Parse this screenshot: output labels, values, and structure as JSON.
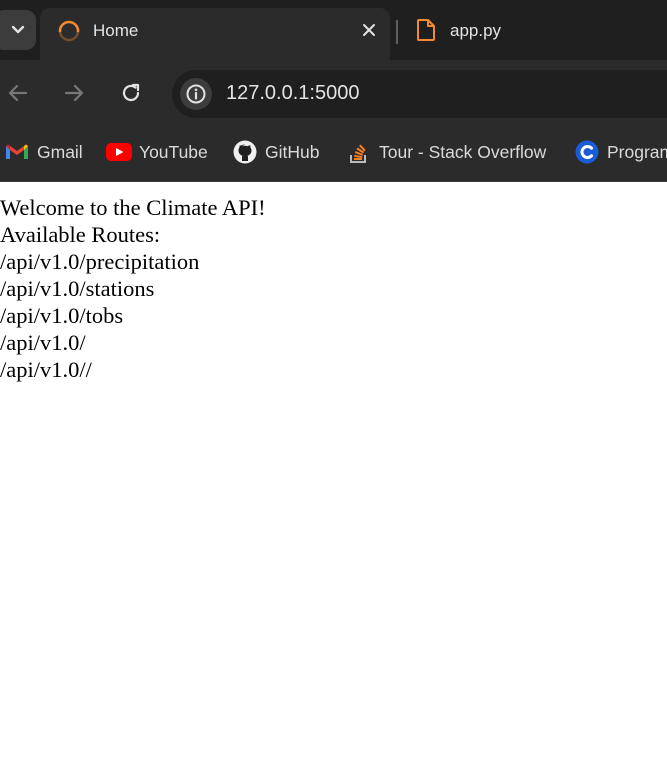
{
  "tabs": [
    {
      "title": "Home",
      "icon": "loading-spinner-icon",
      "active": true
    },
    {
      "title": "app.py",
      "icon": "file-icon",
      "active": false
    }
  ],
  "toolbar": {
    "url": "127.0.0.1:5000"
  },
  "bookmarks": [
    {
      "label": "Gmail",
      "icon": "gmail-icon"
    },
    {
      "label": "YouTube",
      "icon": "youtube-icon"
    },
    {
      "label": "GitHub",
      "icon": "github-icon"
    },
    {
      "label": "Tour - Stack Overflow",
      "icon": "stackoverflow-icon"
    },
    {
      "label": "Program",
      "icon": "program-icon"
    }
  ],
  "page": {
    "welcome": "Welcome to the Climate API!",
    "routes_heading": "Available Routes:",
    "routes": [
      "/api/v1.0/precipitation",
      "/api/v1.0/stations",
      "/api/v1.0/tobs",
      "/api/v1.0/",
      "/api/v1.0//"
    ]
  },
  "colors": {
    "tabstrip": "#1f1f1f",
    "toolbar": "#2b2b2b",
    "accent_orange": "#f28b30"
  }
}
